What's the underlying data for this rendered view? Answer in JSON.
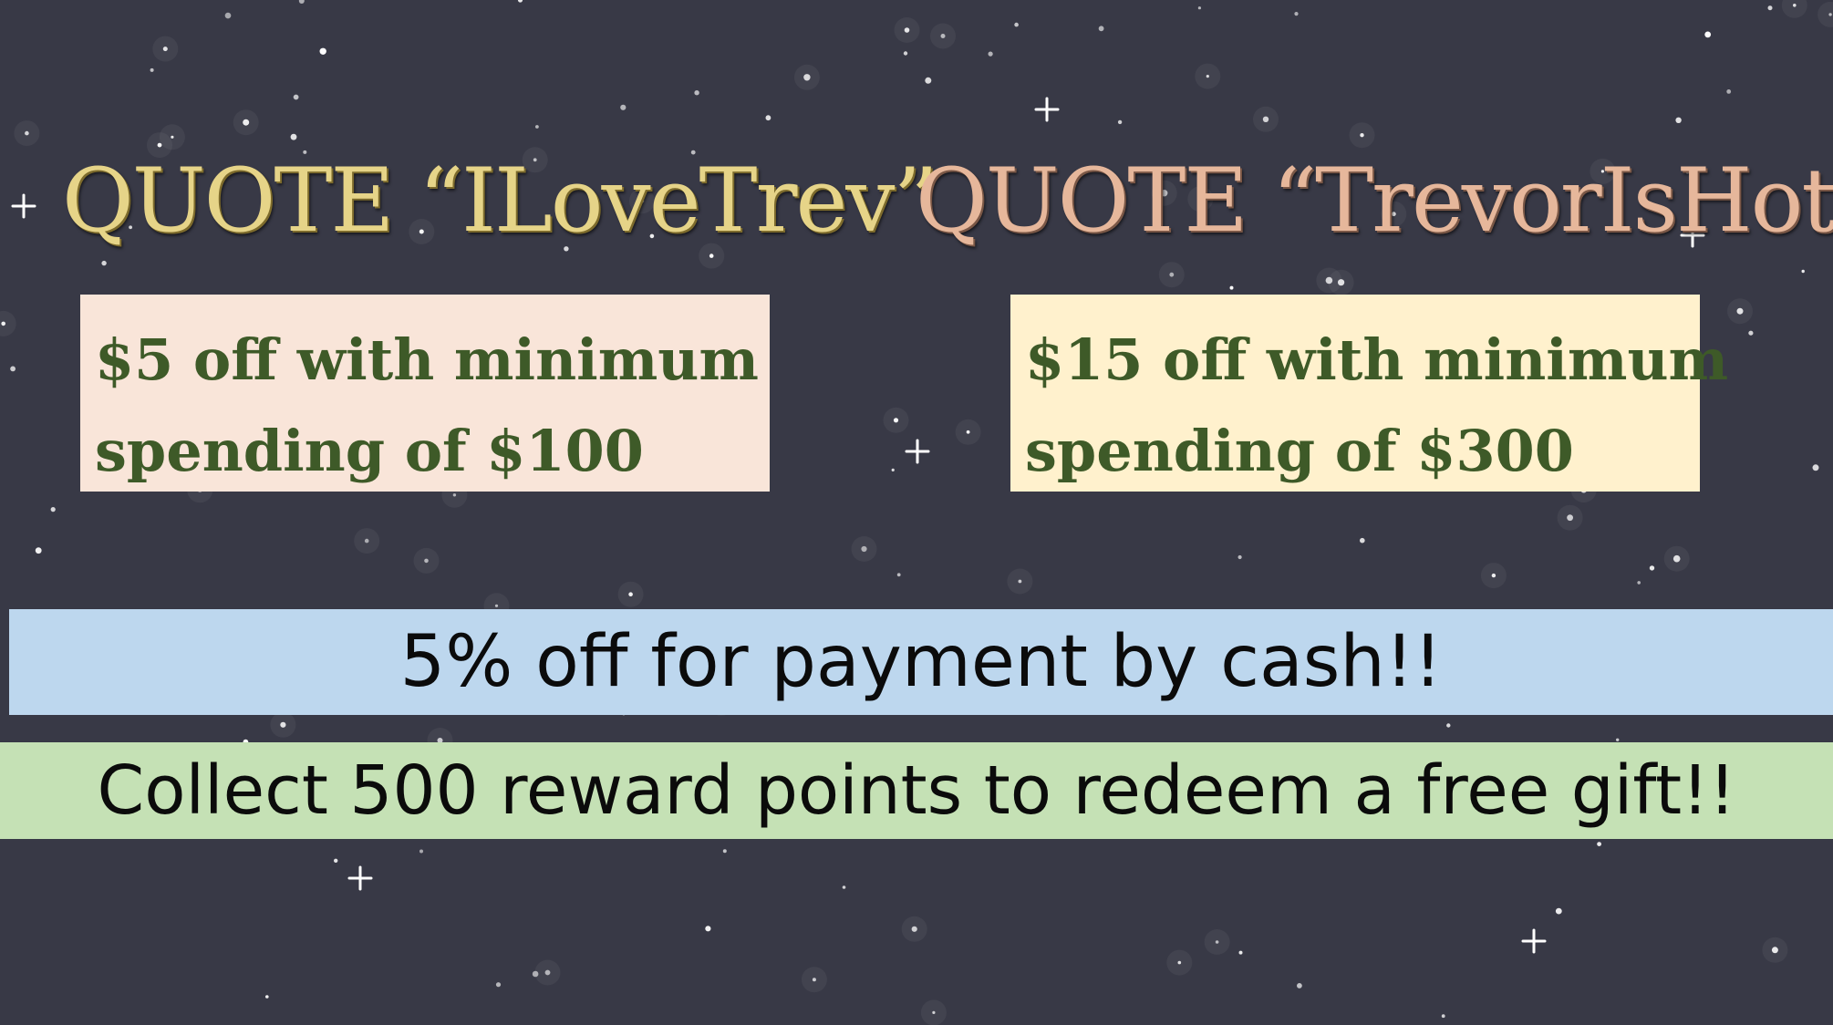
{
  "promo_codes": [
    {
      "code_label": "QUOTE “ILoveTrev”",
      "offer_line_1": "$5 off with minimum",
      "offer_line_2": "spending of $100",
      "title_color": "#e6d488",
      "box_color": "#f9e5d9"
    },
    {
      "code_label": "QUOTE “TrevorIsHot”",
      "offer_line_1": "$15 off with minimum",
      "offer_line_2": "spending of $300",
      "title_color": "#e6b79b",
      "box_color": "#fff1cd"
    }
  ],
  "banners": {
    "cash": {
      "text": "5% off for payment by cash!!",
      "color": "#bdd7ee"
    },
    "points": {
      "text": "Collect 500 reward points to redeem a free gift!!",
      "color": "#c5e1b5"
    }
  },
  "colors": {
    "background": "#383946",
    "offer_text": "#3e5a28"
  },
  "background_pattern": "starry-night"
}
